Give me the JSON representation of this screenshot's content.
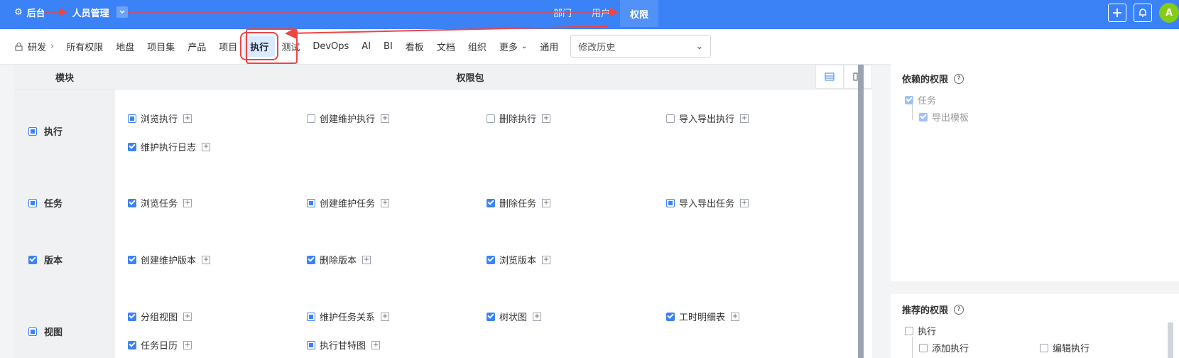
{
  "topbar": {
    "backend": "后台",
    "people": "人员管理",
    "nav": [
      "部门",
      "用户",
      "权限"
    ],
    "active_nav": "权限",
    "avatar": "A"
  },
  "subbar": {
    "root": "研发",
    "tabs": [
      "所有权限",
      "地盘",
      "项目集",
      "产品",
      "项目",
      "执行",
      "测试",
      "DevOps",
      "AI",
      "BI",
      "看板",
      "文档",
      "组织",
      "更多",
      "通用"
    ],
    "active_tab": "执行",
    "history_placeholder": "修改历史"
  },
  "table": {
    "col_module": "模块",
    "col_pkg": "权限包",
    "rows": [
      {
        "module": "执行",
        "perms": [
          "浏览执行",
          "创建维护执行",
          "删除执行",
          "导入导出执行",
          "维护执行日志"
        ]
      },
      {
        "module": "任务",
        "perms": [
          "浏览任务",
          "创建维护任务",
          "删除任务",
          "导入导出任务"
        ]
      },
      {
        "module": "版本",
        "perms": [
          "创建维护版本",
          "删除版本",
          "浏览版本"
        ]
      },
      {
        "module": "视图",
        "perms": [
          "分组视图",
          "维护任务关系",
          "树状图",
          "工时明细表",
          "任务日历",
          "执行甘特图"
        ]
      }
    ]
  },
  "dep_panel": {
    "title": "依赖的权限",
    "items": [
      "任务",
      "导出模板"
    ]
  },
  "rec_panel": {
    "title": "推荐的权限",
    "items": [
      "执行",
      "添加执行",
      "编辑执行"
    ]
  }
}
